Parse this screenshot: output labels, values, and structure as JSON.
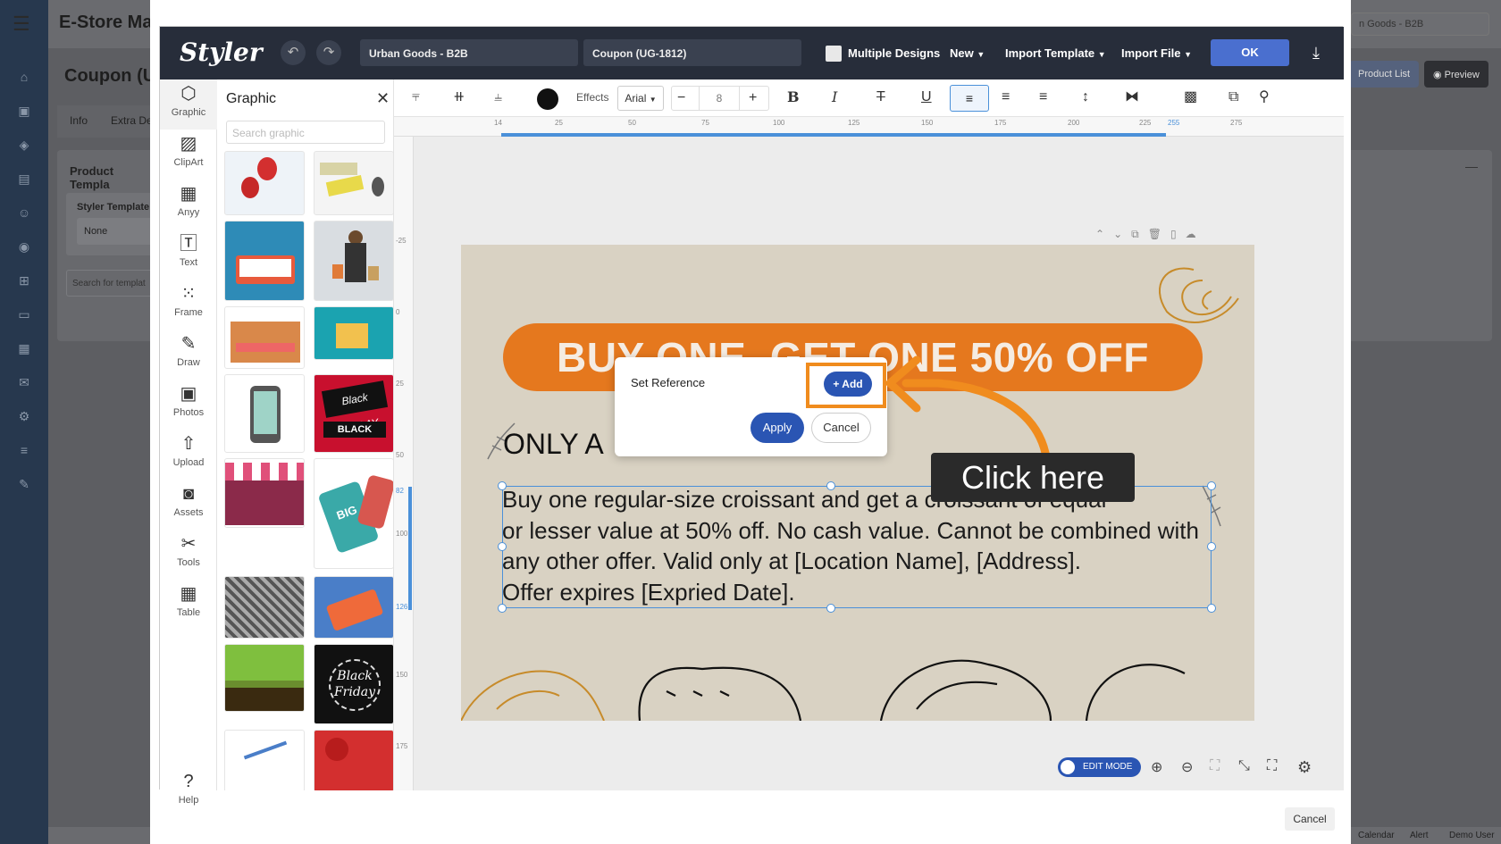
{
  "background_app": {
    "title": "E-Store Mar",
    "page_title": "Coupon (U",
    "store_selector": "n Goods - B2B",
    "product_list_label": "Product List",
    "preview_label": "Preview",
    "tabs": [
      "Info",
      "Extra De"
    ],
    "card_title": "Product Templa",
    "styler_template_label": "Styler Template",
    "styler_template_value": "None",
    "search_templates_placeholder": "Search for templat",
    "status_items": [
      "Calendar",
      "Alert",
      "Demo User"
    ]
  },
  "styler": {
    "logo": "Styler",
    "store_name": "Urban Goods - B2B",
    "coupon_name": "Coupon (UG-1812)",
    "multiple_designs_label": "Multiple Designs",
    "menus": [
      "New",
      "Import Template",
      "Import File"
    ],
    "ok_label": "OK",
    "rail_items": [
      "Graphic",
      "ClipArt",
      "Anyy",
      "Text",
      "Frame",
      "Draw",
      "Photos",
      "Upload",
      "Assets",
      "Tools",
      "Table"
    ],
    "help_label": "Help",
    "panel_title": "Graphic",
    "search_placeholder": "Search graphic",
    "toolbar": {
      "effects_label": "Effects",
      "font": "Arial",
      "font_size": "8"
    },
    "ruler_h": [
      "14",
      "25",
      "50",
      "75",
      "100",
      "125",
      "150",
      "175",
      "200",
      "225",
      "255",
      "275"
    ],
    "ruler_v": [
      "-25",
      "0",
      "25",
      "50",
      "82",
      "100",
      "126",
      "150",
      "175"
    ],
    "canvas": {
      "banner": "BUY ONE, GET ONE 50% OFF",
      "only_text": "ONLY A",
      "body_lines": [
        "Buy one regular-size croissant and get a croissant of equal",
        "or lesser value at 50% off. No cash value. Cannot be combined with",
        "any other offer. Valid only at [Location Name], [Address].",
        "Offer expires [Expried Date]."
      ]
    },
    "edit_mode_label": "EDIT MODE",
    "modal_cancel": "Cancel"
  },
  "dialog": {
    "title": "Set Reference",
    "add_label": "+ Add",
    "apply_label": "Apply",
    "cancel_label": "Cancel"
  },
  "callout": {
    "text": "Click here",
    "color": "#f08c1e"
  },
  "colors": {
    "brand_dark": "#272d3a",
    "accent_blue": "#2a55b3",
    "banner_orange": "#e5781e"
  }
}
